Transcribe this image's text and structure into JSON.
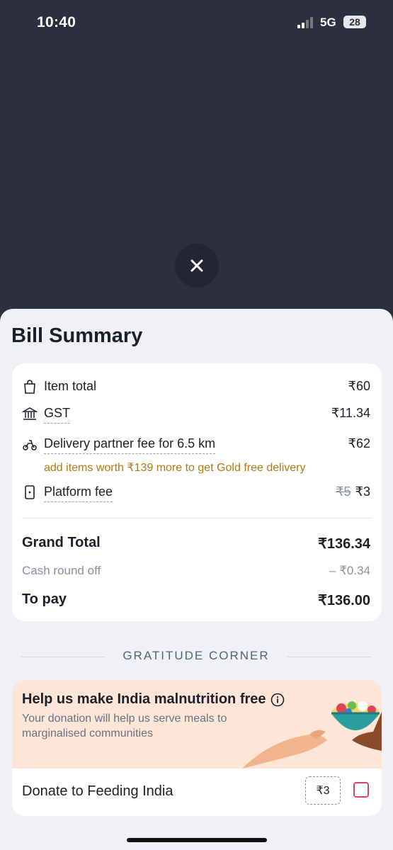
{
  "status_bar": {
    "time": "10:40",
    "network": "5G",
    "battery": "28"
  },
  "bill": {
    "title": "Bill Summary",
    "items": [
      {
        "icon": "bag-icon",
        "label": "Item total",
        "value": "₹60"
      },
      {
        "icon": "bank-icon",
        "label": "GST",
        "value": "₹11.34"
      },
      {
        "icon": "scooter-icon",
        "label": "Delivery partner fee for 6.5 km",
        "value": "₹62",
        "hint": "add items worth ₹139 more to get Gold free delivery"
      },
      {
        "icon": "phone-icon",
        "label": "Platform fee",
        "old_value": "₹5",
        "value": "₹3"
      }
    ],
    "grand_total_label": "Grand Total",
    "grand_total_value": "₹136.34",
    "round_off_label": "Cash round off",
    "round_off_value": "– ₹0.34",
    "to_pay_label": "To pay",
    "to_pay_value": "₹136.00"
  },
  "gratitude": {
    "section_title": "GRATITUDE CORNER",
    "card_title": "Help us make India malnutrition free",
    "card_desc": "Your donation will help us serve meals to marginalised communities",
    "donate_label": "Donate to Feeding India",
    "donate_amount": "₹3",
    "donate_checked": false
  },
  "colors": {
    "accent": "#d9465b",
    "hint": "#b07a12",
    "overlay": "#2b2f3f"
  }
}
